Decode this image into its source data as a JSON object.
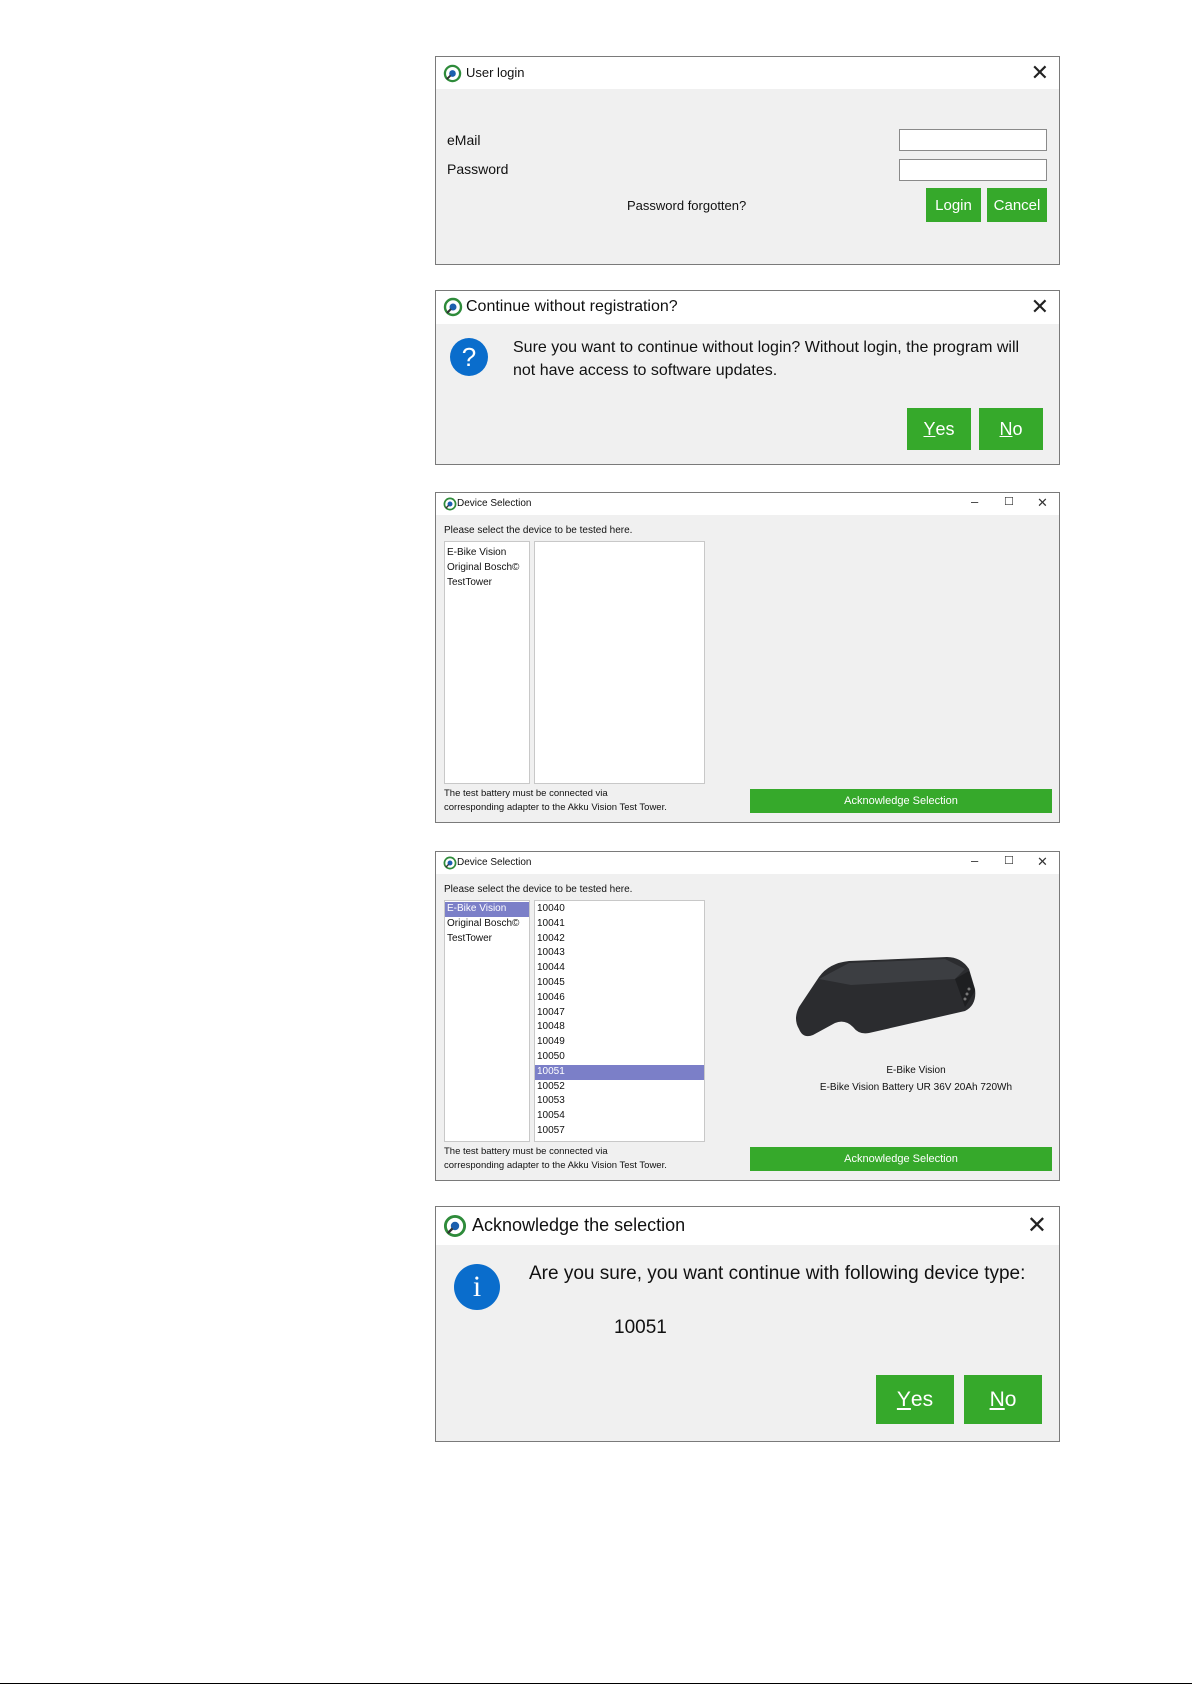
{
  "colors": {
    "accent_green": "#36a92b",
    "selection": "#7b7fc8",
    "info_blue": "#0a6dcc"
  },
  "login": {
    "title": "User login",
    "email_label": "eMail",
    "password_label": "Password",
    "email_value": "",
    "password_value": "",
    "forgot": "Password forgotten?",
    "login_btn": "Login",
    "cancel_btn": "Cancel"
  },
  "continue_dialog": {
    "title": "Continue without registration?",
    "message_line1": "Sure you want to continue without login? Without login, the program will",
    "message_line2": "not have access to software updates.",
    "icon": "question-icon",
    "yes_mnemonic": "Y",
    "yes_rest": "es",
    "no_mnemonic": "N",
    "no_rest": "o"
  },
  "device_empty": {
    "title": "Device Selection",
    "instruction": "Please select the device to be tested here.",
    "categories": [
      "E-Bike Vision",
      "Original Bosch©",
      "TestTower"
    ],
    "note_line1": "The test battery must be connected via",
    "note_line2": "corresponding adapter to the Akku Vision Test Tower.",
    "ack_btn": "Acknowledge Selection"
  },
  "device_selected": {
    "title": "Device Selection",
    "instruction": "Please select the device to be tested here.",
    "categories": [
      "E-Bike Vision",
      "Original Bosch©",
      "TestTower"
    ],
    "devices": [
      "10040",
      "10041",
      "10042",
      "10043",
      "10044",
      "10045",
      "10046",
      "10047",
      "10048",
      "10049",
      "10050",
      "10051",
      "10052",
      "10053",
      "10054",
      "10057"
    ],
    "selected_device": "10051",
    "product_name": "E-Bike Vision",
    "product_desc": "E-Bike Vision Battery UR 36V 20Ah 720Wh",
    "note_line1": "The test battery must be connected via",
    "note_line2": "corresponding adapter to the Akku Vision Test Tower.",
    "ack_btn": "Acknowledge Selection"
  },
  "ack_dialog": {
    "title": "Acknowledge the selection",
    "message": "Are you sure, you want continue with following device type:",
    "device": "10051",
    "icon": "info-icon",
    "yes_mnemonic": "Y",
    "yes_rest": "es",
    "no_mnemonic": "N",
    "no_rest": "o"
  }
}
